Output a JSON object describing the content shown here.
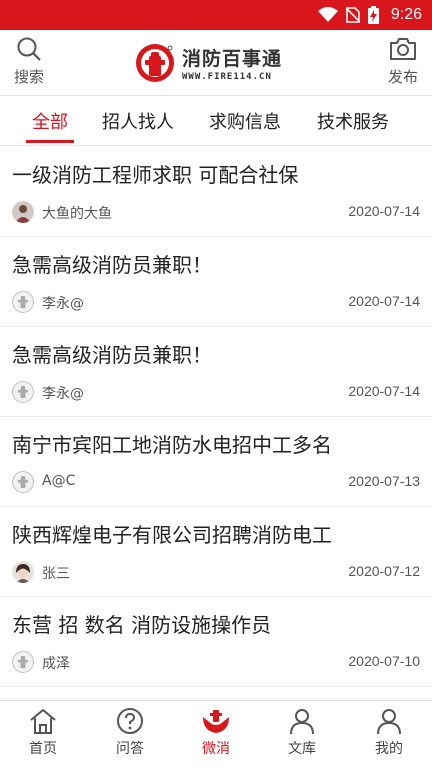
{
  "status_bar": {
    "time": "9:26"
  },
  "header": {
    "search_label": "搜索",
    "publish_label": "发布",
    "logo_title": "消防百事通",
    "logo_url": "WWW.FIRE114.CN"
  },
  "tabs": [
    {
      "label": "全部",
      "active": true
    },
    {
      "label": "招人找人",
      "active": false
    },
    {
      "label": "求购信息",
      "active": false
    },
    {
      "label": "技术服务",
      "active": false
    }
  ],
  "posts": [
    {
      "title": "一级消防工程师求职 可配合社保",
      "author": "大鱼的大鱼",
      "date": "2020-07-14",
      "avatar": "photo"
    },
    {
      "title": "急需高级消防员兼职！",
      "author": "李永@",
      "date": "2020-07-14",
      "avatar": "default"
    },
    {
      "title": "急需高级消防员兼职！",
      "author": "李永@",
      "date": "2020-07-14",
      "avatar": "default"
    },
    {
      "title": "南宁市宾阳工地消防水电招中工多名",
      "author": "A@C",
      "date": "2020-07-13",
      "avatar": "default"
    },
    {
      "title": "陕西辉煌电子有限公司招聘消防电工",
      "author": "张三",
      "date": "2020-07-12",
      "avatar": "photo"
    },
    {
      "title": "东营 招 数名 消防设施操作员",
      "author": "成泽",
      "date": "2020-07-10",
      "avatar": "default"
    }
  ],
  "bottom_nav": [
    {
      "label": "首页",
      "icon": "home-icon",
      "active": false
    },
    {
      "label": "问答",
      "icon": "question-icon",
      "active": false
    },
    {
      "label": "微消",
      "icon": "hands-icon",
      "active": true
    },
    {
      "label": "文库",
      "icon": "person-icon",
      "active": false
    },
    {
      "label": "我的",
      "icon": "user-icon",
      "active": false
    }
  ],
  "colors": {
    "brand_red": "#d8161c",
    "text": "#222222",
    "muted": "#555555"
  }
}
